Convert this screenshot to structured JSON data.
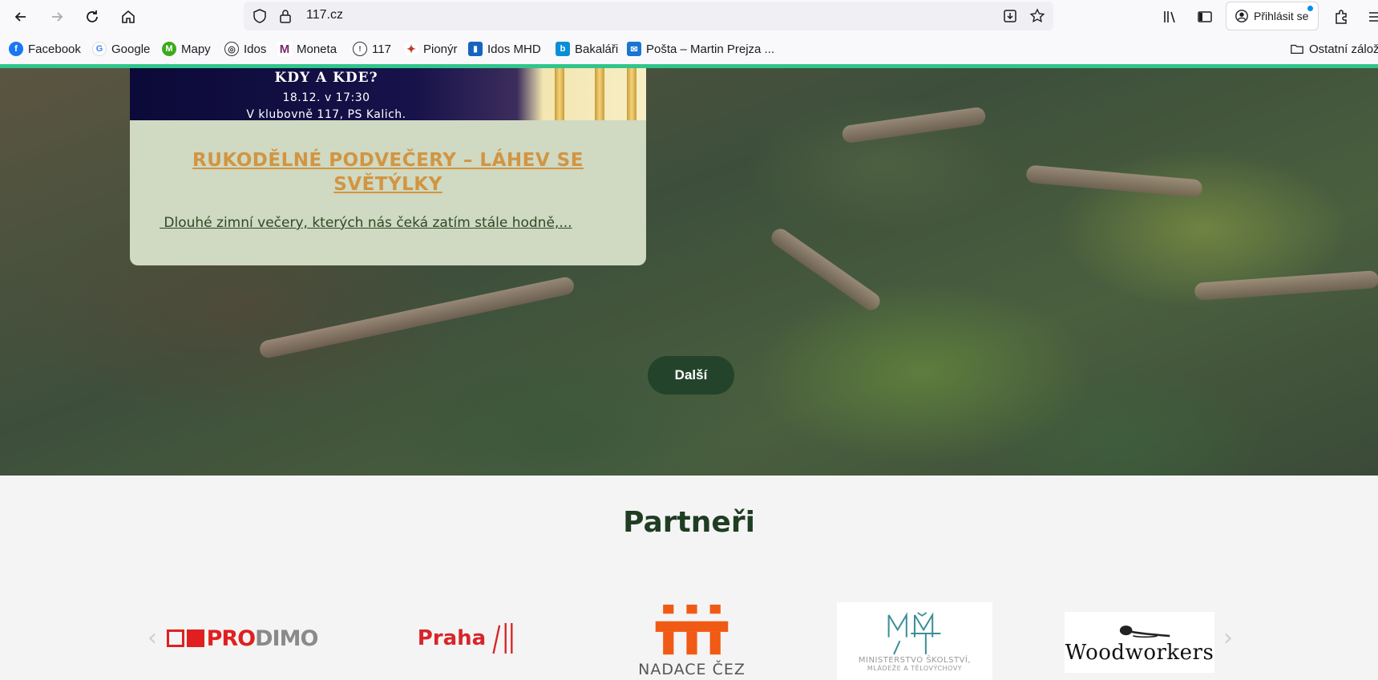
{
  "browser": {
    "url": "117.cz",
    "signin_label": "Přihlásit se",
    "bookmarks": [
      {
        "label": "Facebook",
        "icon": "facebook-icon",
        "color": "#1877f2"
      },
      {
        "label": "Google",
        "icon": "google-icon",
        "color": "#4285f4"
      },
      {
        "label": "Mapy",
        "icon": "mapy-icon",
        "color": "#3bab1c"
      },
      {
        "label": "Idos",
        "icon": "globe-icon",
        "color": "#333333"
      },
      {
        "label": "Moneta",
        "icon": "moneta-icon",
        "color": "#7a2a6e"
      },
      {
        "label": "117",
        "icon": "badge-117-icon",
        "color": "#333333"
      },
      {
        "label": "Pionýr",
        "icon": "pionyr-icon",
        "color": "#c0392b"
      },
      {
        "label": "Idos MHD",
        "icon": "idos-mhd-icon",
        "color": "#1565c0"
      },
      {
        "label": "Bakaláři",
        "icon": "bakalari-icon",
        "color": "#0a8fd6"
      },
      {
        "label": "Pošta – Martin Prejza ...",
        "icon": "mail-icon",
        "color": "#1976d2"
      }
    ],
    "other_bookmarks": "Ostatní zálož"
  },
  "card": {
    "image_title": "KDY A KDE?",
    "image_line1": "18.12. v 17:30",
    "image_line2": "V klubovně 117, PS Kalich.",
    "title": "RUKODĚLNÉ PODVEČERY – LÁHEV SE SVĚTÝLKY",
    "excerpt": " Dlouhé zimní večery, kterých nás čeká zatím stále hodně,..."
  },
  "next_button": "Další",
  "partners": {
    "heading": "Partneři",
    "logos": {
      "prodimo": {
        "prefix": "PRO",
        "suffix": "DIMO"
      },
      "praha": "Praha",
      "cez": "NADACE ČEZ",
      "msmt_line1": "MINISTERSTVO ŠKOLSTVÍ,",
      "msmt_line2": "MLÁDEŽE A TĚLOVÝCHOVY",
      "woodworkers": "Woodworkers"
    }
  },
  "colors": {
    "accent_green": "#2fc58b",
    "card_title": "#d19542",
    "button_bg": "#24432b",
    "heading": "#1f3d23"
  }
}
